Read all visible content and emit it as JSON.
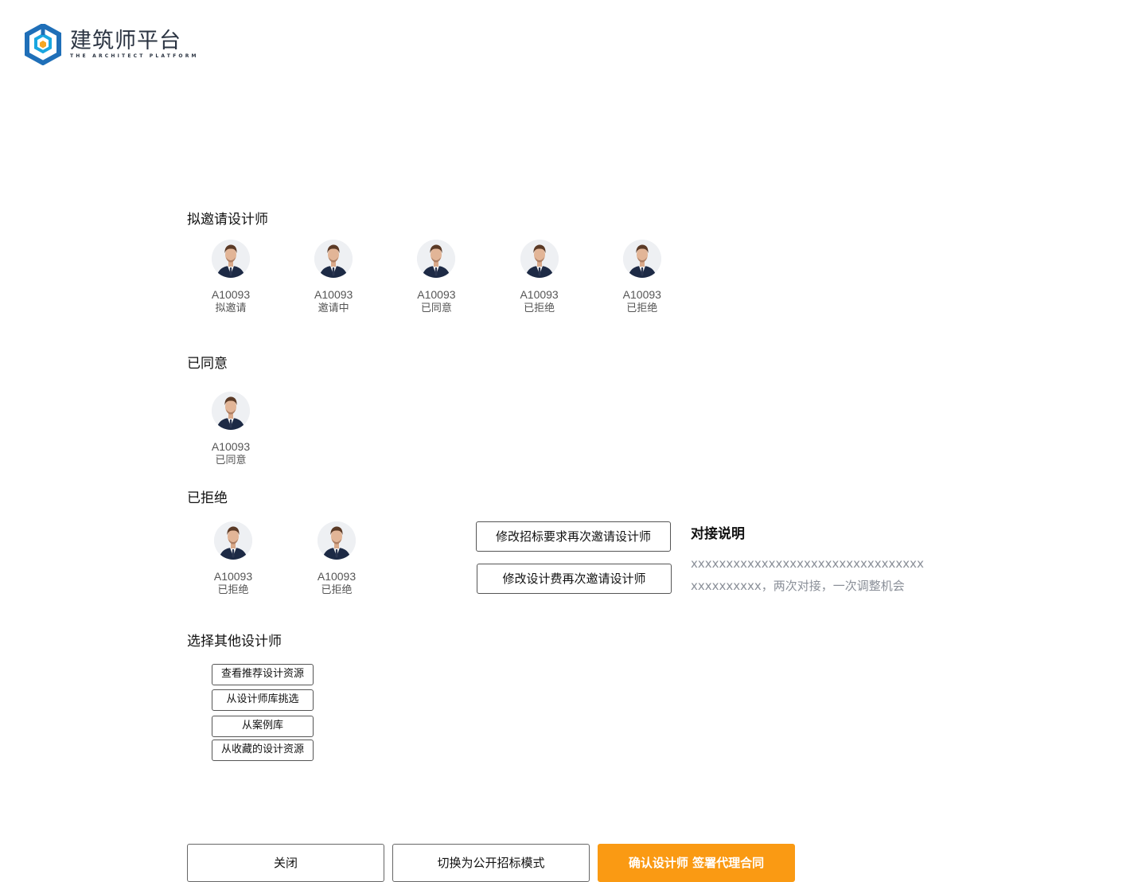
{
  "logo": {
    "title_cn": "建筑师平台",
    "title_en": "THE ARCHITECT PLATFORM"
  },
  "sections": {
    "invite_title": "拟邀请设计师",
    "agreed_title": "已同意",
    "rejected_title": "已拒绝",
    "other_title": "选择其他设计师"
  },
  "invite_designers": [
    {
      "id": "A10093",
      "status": "拟邀请"
    },
    {
      "id": "A10093",
      "status": "邀请中"
    },
    {
      "id": "A10093",
      "status": "已同意"
    },
    {
      "id": "A10093",
      "status": "已拒绝"
    },
    {
      "id": "A10093",
      "status": "已拒绝"
    }
  ],
  "agreed_designers": [
    {
      "id": "A10093",
      "status": "已同意"
    }
  ],
  "rejected_designers": [
    {
      "id": "A10093",
      "status": "已拒绝"
    },
    {
      "id": "A10093",
      "status": "已拒绝"
    }
  ],
  "reinvite_actions": {
    "modify_requirements_label": "修改招标要求再次邀请设计师",
    "modify_fee_label": "修改设计费再次邀请设计师"
  },
  "note": {
    "title": "对接说明",
    "body": "xxxxxxxxxxxxxxxxxxxxxxxxxxxxxxxxxxxxxxxxxxx，两次对接，一次调整机会"
  },
  "other_actions": {
    "recommended_label": "查看推荐设计资源",
    "library_label": "从设计师库挑选",
    "cases_label": "从案例库",
    "favorites_label": "从收藏的设计资源"
  },
  "footer": {
    "close_label": "关闭",
    "switch_label": "切换为公开招标模式",
    "confirm_label": "确认设计师 签署代理合同"
  },
  "colors": {
    "accent": "#fa9a13",
    "logo_blue": "#1f6fb8",
    "logo_cyan": "#19a6e0"
  }
}
